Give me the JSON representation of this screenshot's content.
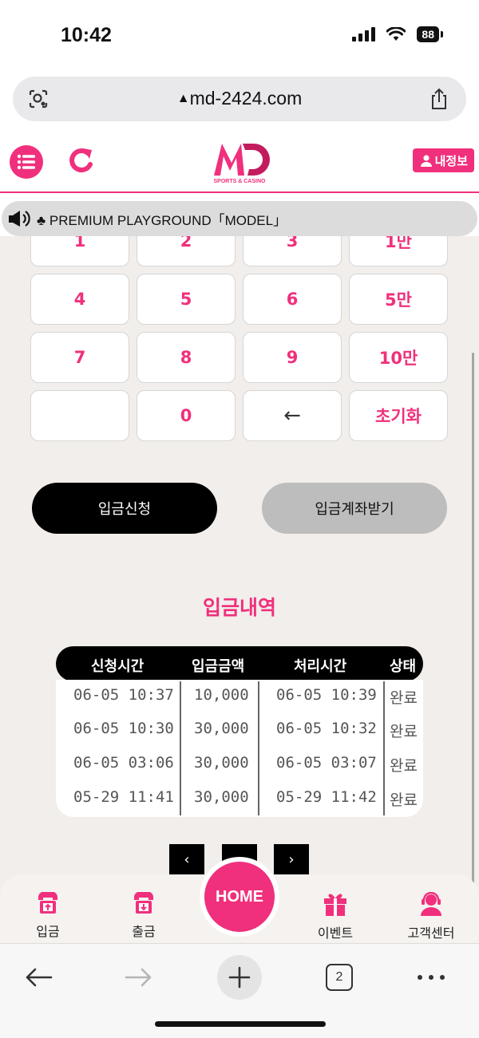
{
  "status": {
    "time": "10:42",
    "battery": "88"
  },
  "browser": {
    "url": "md-2424.com",
    "tab_count": "2"
  },
  "header": {
    "logo_text": "SPORTS & CASINO",
    "my_info_label": "내정보"
  },
  "marquee": {
    "text": "♣ PREMIUM PLAYGROUND「MODEL」"
  },
  "keypad": {
    "keys": [
      "1",
      "2",
      "3",
      "1만",
      "4",
      "5",
      "6",
      "5만",
      "7",
      "8",
      "9",
      "10만",
      "",
      "0",
      "←",
      "초기화"
    ]
  },
  "actions": {
    "apply_label": "입금신청",
    "account_label": "입금계좌받기"
  },
  "history": {
    "title": "입금내역",
    "headers": [
      "신청시간",
      "입금금액",
      "처리시간",
      "상태"
    ],
    "rows": [
      [
        "06-05 10:37",
        "10,000",
        "06-05 10:39",
        "완료"
      ],
      [
        "06-05 10:30",
        "30,000",
        "06-05 10:32",
        "완료"
      ],
      [
        "06-05 03:06",
        "30,000",
        "06-05 03:07",
        "완료"
      ],
      [
        "05-29 11:41",
        "30,000",
        "05-29 11:42",
        "완료"
      ]
    ]
  },
  "pager": {
    "prev": "‹",
    "next": "›"
  },
  "bottom_nav": {
    "deposit": "입금",
    "withdraw": "출금",
    "home": "HOME",
    "event": "이벤트",
    "support": "고객센터"
  },
  "colors": {
    "accent": "#f0307c",
    "background": "#f1eeeb"
  }
}
